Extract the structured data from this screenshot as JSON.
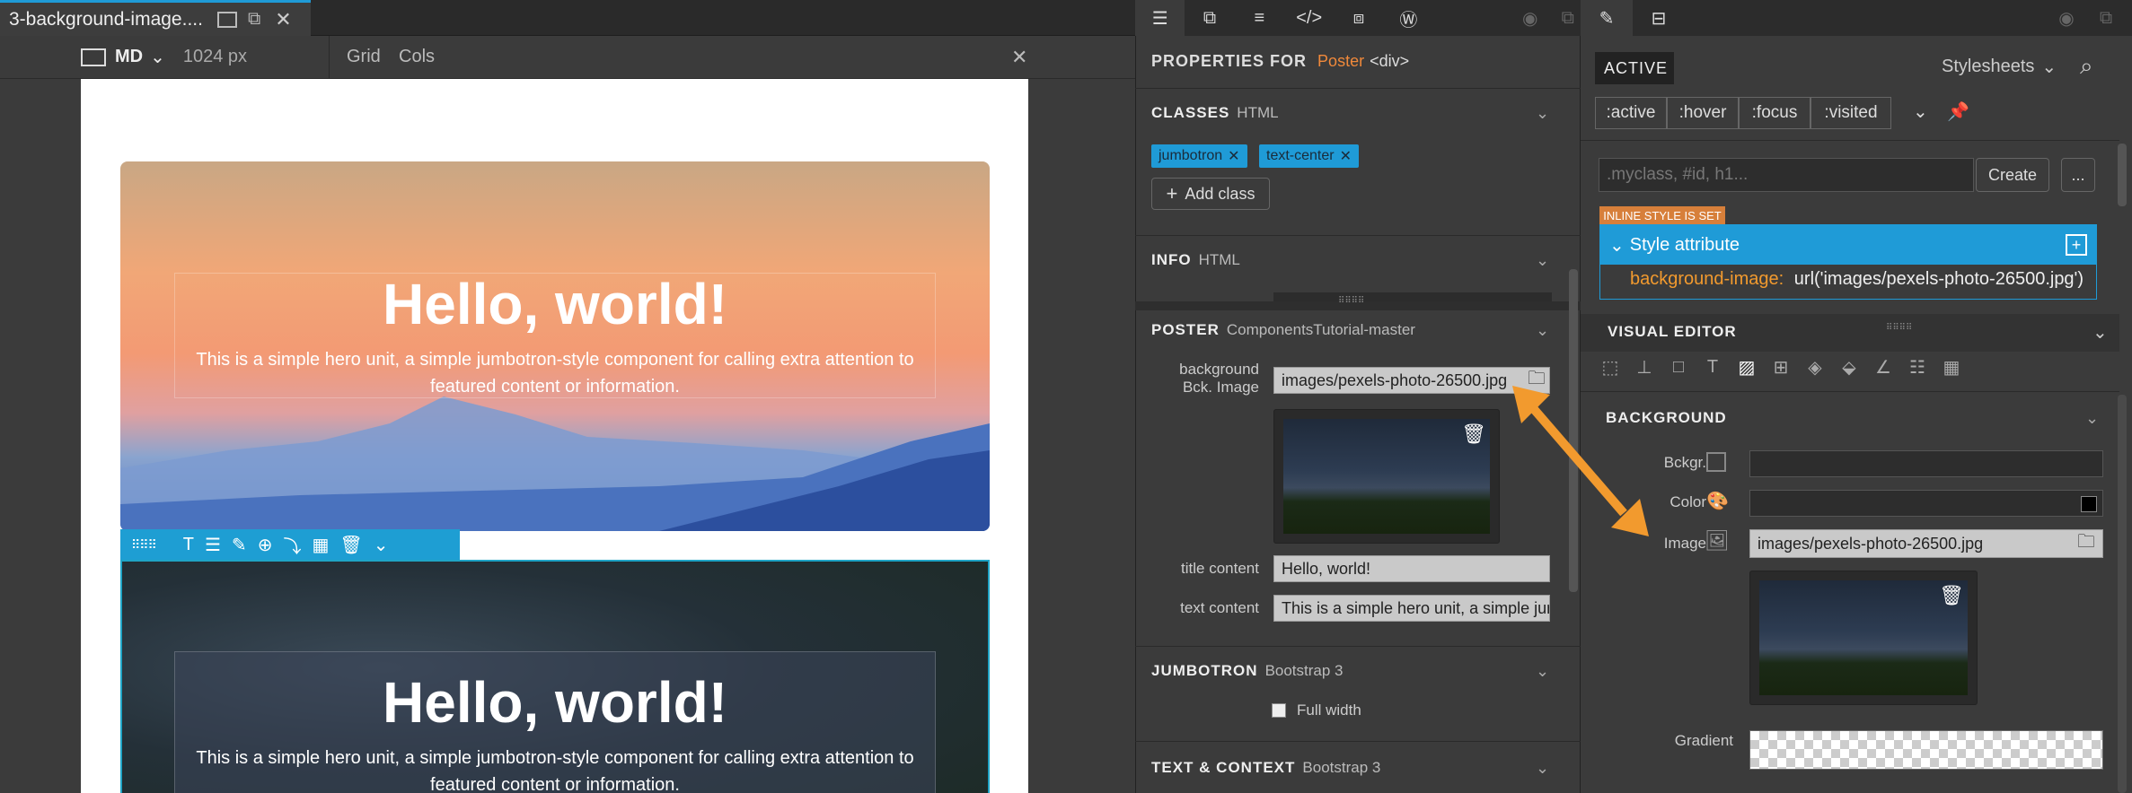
{
  "editor_tab": {
    "title": "3-background-image...."
  },
  "canvas_bar": {
    "device": "MD",
    "width": "1024 px",
    "grid": "Grid",
    "cols": "Cols"
  },
  "hero1": {
    "title": "Hello, world!",
    "text": "This is a simple hero unit, a simple jumbotron-style component for calling extra attention to featured content or information."
  },
  "hero2": {
    "title": "Hello, world!",
    "text": "This is a simple hero unit, a simple jumbotron-style component for calling extra attention to featured content or information."
  },
  "properties": {
    "title_prefix": "PROPERTIES FOR",
    "element_name": "Poster",
    "element_tag": "<div>",
    "classes": {
      "title": "CLASSES",
      "sub": "HTML",
      "tags": [
        "jumbotron",
        "text-center"
      ],
      "add_label": "Add class"
    },
    "info": {
      "title": "INFO",
      "sub": "HTML"
    },
    "poster": {
      "title": "POSTER",
      "sub": "ComponentsTutorial-master",
      "bg_label_1": "background",
      "bg_label_2": "Bck. Image",
      "bg_value": "images/pexels-photo-26500.jpg",
      "title_label": "title content",
      "title_value": "Hello, world!",
      "text_label": "text content",
      "text_value": "This is a simple hero unit, a simple jumbotron-style component"
    },
    "jumbotron": {
      "title": "JUMBOTRON",
      "sub": "Bootstrap 3",
      "full_width": "Full width"
    },
    "text_context": {
      "title": "TEXT & CONTEXT",
      "sub": "Bootstrap 3"
    }
  },
  "styles": {
    "active_label": "ACTIVE",
    "stylesheets": "Stylesheets",
    "states": [
      ":active",
      ":hover",
      ":focus",
      ":visited"
    ],
    "selector_placeholder": ".myclass, #id, h1...",
    "create": "Create",
    "more": "...",
    "inline_badge": "INLINE STYLE IS SET",
    "style_attribute": "Style attribute",
    "rule_prop": "background-image:",
    "rule_value": "url('images/pexels-photo-26500.jpg')",
    "visual_editor": "VISUAL EDITOR",
    "background": {
      "title": "BACKGROUND",
      "bckgr": "Bckgr.",
      "color": "Color",
      "image": "Image",
      "image_value": "images/pexels-photo-26500.jpg",
      "gradient": "Gradient"
    }
  },
  "colors": {
    "accent": "#1f9bd7",
    "orange": "#f29a2e",
    "inline_badge": "#d77f3a",
    "poster_name": "#f0893b"
  }
}
